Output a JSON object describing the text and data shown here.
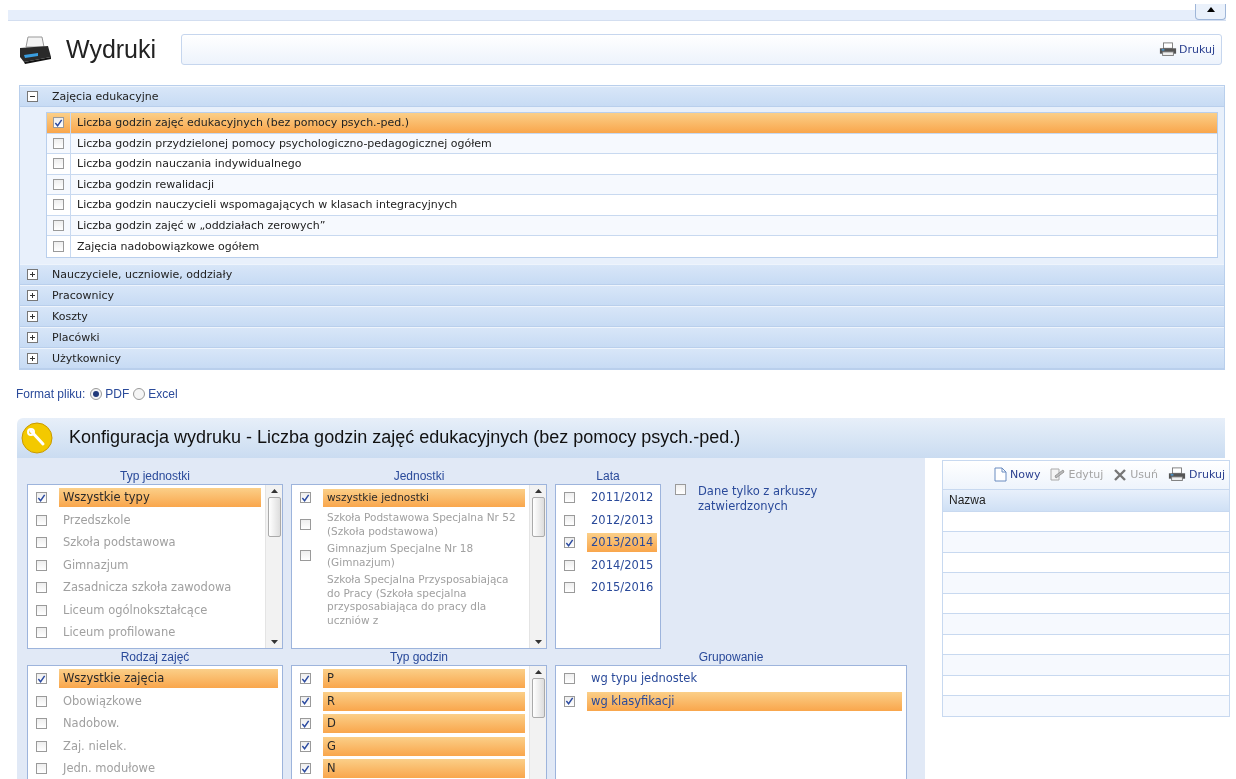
{
  "header": {
    "title": "Wydruki",
    "print_button": "Drukuj"
  },
  "report_groups": [
    {
      "title": "Zajęcia edukacyjne",
      "expanded": true,
      "items": [
        {
          "label": "Liczba godzin zajęć edukacyjnych (bez pomocy psych.-ped.)",
          "checked": true
        },
        {
          "label": "Liczba godzin przydzielonej pomocy psychologiczno-pedagogicznej ogółem",
          "checked": false
        },
        {
          "label": "Liczba godzin nauczania indywidualnego",
          "checked": false
        },
        {
          "label": "Liczba godzin rewalidacji",
          "checked": false
        },
        {
          "label": "Liczba godzin nauczycieli wspomagających w klasach integracyjnych",
          "checked": false
        },
        {
          "label": "Liczba godzin zajęć w „oddziałach zerowych”",
          "checked": false
        },
        {
          "label": "Zajęcia nadobowiązkowe ogółem",
          "checked": false
        }
      ]
    },
    {
      "title": "Nauczyciele, uczniowie, oddziały",
      "expanded": false
    },
    {
      "title": "Pracownicy",
      "expanded": false
    },
    {
      "title": "Koszty",
      "expanded": false
    },
    {
      "title": "Placówki",
      "expanded": false
    },
    {
      "title": "Użytkownicy",
      "expanded": false
    }
  ],
  "file_format": {
    "label": "Format pliku:",
    "options": [
      {
        "label": "PDF",
        "selected": true
      },
      {
        "label": "Excel",
        "selected": false
      }
    ]
  },
  "config": {
    "title": "Konfiguracja wydruku - Liczba godzin zajęć edukacyjnych (bez pomocy psych.-ped.)",
    "lists": [
      {
        "title": "Typ jednostki",
        "kind": "scroll",
        "items": [
          {
            "label": "Wszystkie typy",
            "checked": true,
            "disabled": false
          },
          {
            "label": "Przedszkole",
            "checked": false,
            "disabled": true
          },
          {
            "label": "Szkoła podstawowa",
            "checked": false,
            "disabled": true
          },
          {
            "label": "Gimnazjum",
            "checked": false,
            "disabled": true
          },
          {
            "label": "Zasadnicza szkoła zawodowa",
            "checked": false,
            "disabled": true
          },
          {
            "label": "Liceum ogólnokształcące",
            "checked": false,
            "disabled": true
          },
          {
            "label": "Liceum profilowane",
            "checked": false,
            "disabled": true
          }
        ]
      },
      {
        "title": "Jednostki",
        "kind": "scroll",
        "items": [
          {
            "label": "wszystkie jednostki",
            "checked": true,
            "disabled": false
          },
          {
            "label": "Szkoła Podstawowa Specjalna Nr 52 (Szkoła podstawowa)",
            "checked": false,
            "disabled": true
          },
          {
            "label": "Gimnazjum Specjalne Nr 18 (Gimnazjum)",
            "checked": false,
            "disabled": true
          },
          {
            "label": "Szkoła Specjalna Przysposabiająca do Pracy (Szkoła specjalna przysposabiająca do pracy dla uczniów z",
            "disabled": true,
            "kind": "plain"
          }
        ]
      },
      {
        "title": "Lata",
        "kind": "plain",
        "items": [
          {
            "label": "2011/2012",
            "checked": false,
            "disabled": false
          },
          {
            "label": "2012/2013",
            "checked": false,
            "disabled": false
          },
          {
            "label": "2013/2014",
            "checked": true,
            "disabled": false
          },
          {
            "label": "2014/2015",
            "checked": false,
            "disabled": false
          },
          {
            "label": "2015/2016",
            "checked": false,
            "disabled": false
          }
        ]
      },
      {
        "title": "Rodzaj zajęć",
        "kind": "plain",
        "items": [
          {
            "label": "Wszystkie zajęcia",
            "checked": true,
            "disabled": false
          },
          {
            "label": "Obowiązkowe",
            "checked": false,
            "disabled": true
          },
          {
            "label": "Nadobow.",
            "checked": false,
            "disabled": true
          },
          {
            "label": "Zaj. nielek.",
            "checked": false,
            "disabled": true
          },
          {
            "label": "Jedn. modułowe",
            "checked": false,
            "disabled": true
          }
        ]
      },
      {
        "title": "Typ godzin",
        "kind": "scroll",
        "items": [
          {
            "label": "P",
            "checked": true,
            "disabled": false
          },
          {
            "label": "R",
            "checked": true,
            "disabled": false
          },
          {
            "label": "D",
            "checked": true,
            "disabled": false
          },
          {
            "label": "G",
            "checked": true,
            "disabled": false
          },
          {
            "label": "N",
            "checked": true,
            "disabled": false
          }
        ]
      },
      {
        "title": "Grupowanie",
        "kind": "plain",
        "items": [
          {
            "label": "wg typu jednostek",
            "checked": false,
            "disabled": false
          },
          {
            "label": "wg klasyfikacji",
            "checked": true,
            "disabled": false
          }
        ]
      }
    ],
    "approved_only": {
      "label": "Dane tylko z arkuszy zatwierdzonych",
      "checked": false
    }
  },
  "templates": {
    "toolbar": [
      {
        "label": "Nowy",
        "kind": "new",
        "disabled": false
      },
      {
        "label": "Edytuj",
        "kind": "edit",
        "disabled": true
      },
      {
        "label": "Usuń",
        "kind": "delete",
        "disabled": true
      },
      {
        "label": "Drukuj",
        "kind": "print",
        "disabled": false
      }
    ],
    "columns": [
      "Nazwa"
    ]
  }
}
